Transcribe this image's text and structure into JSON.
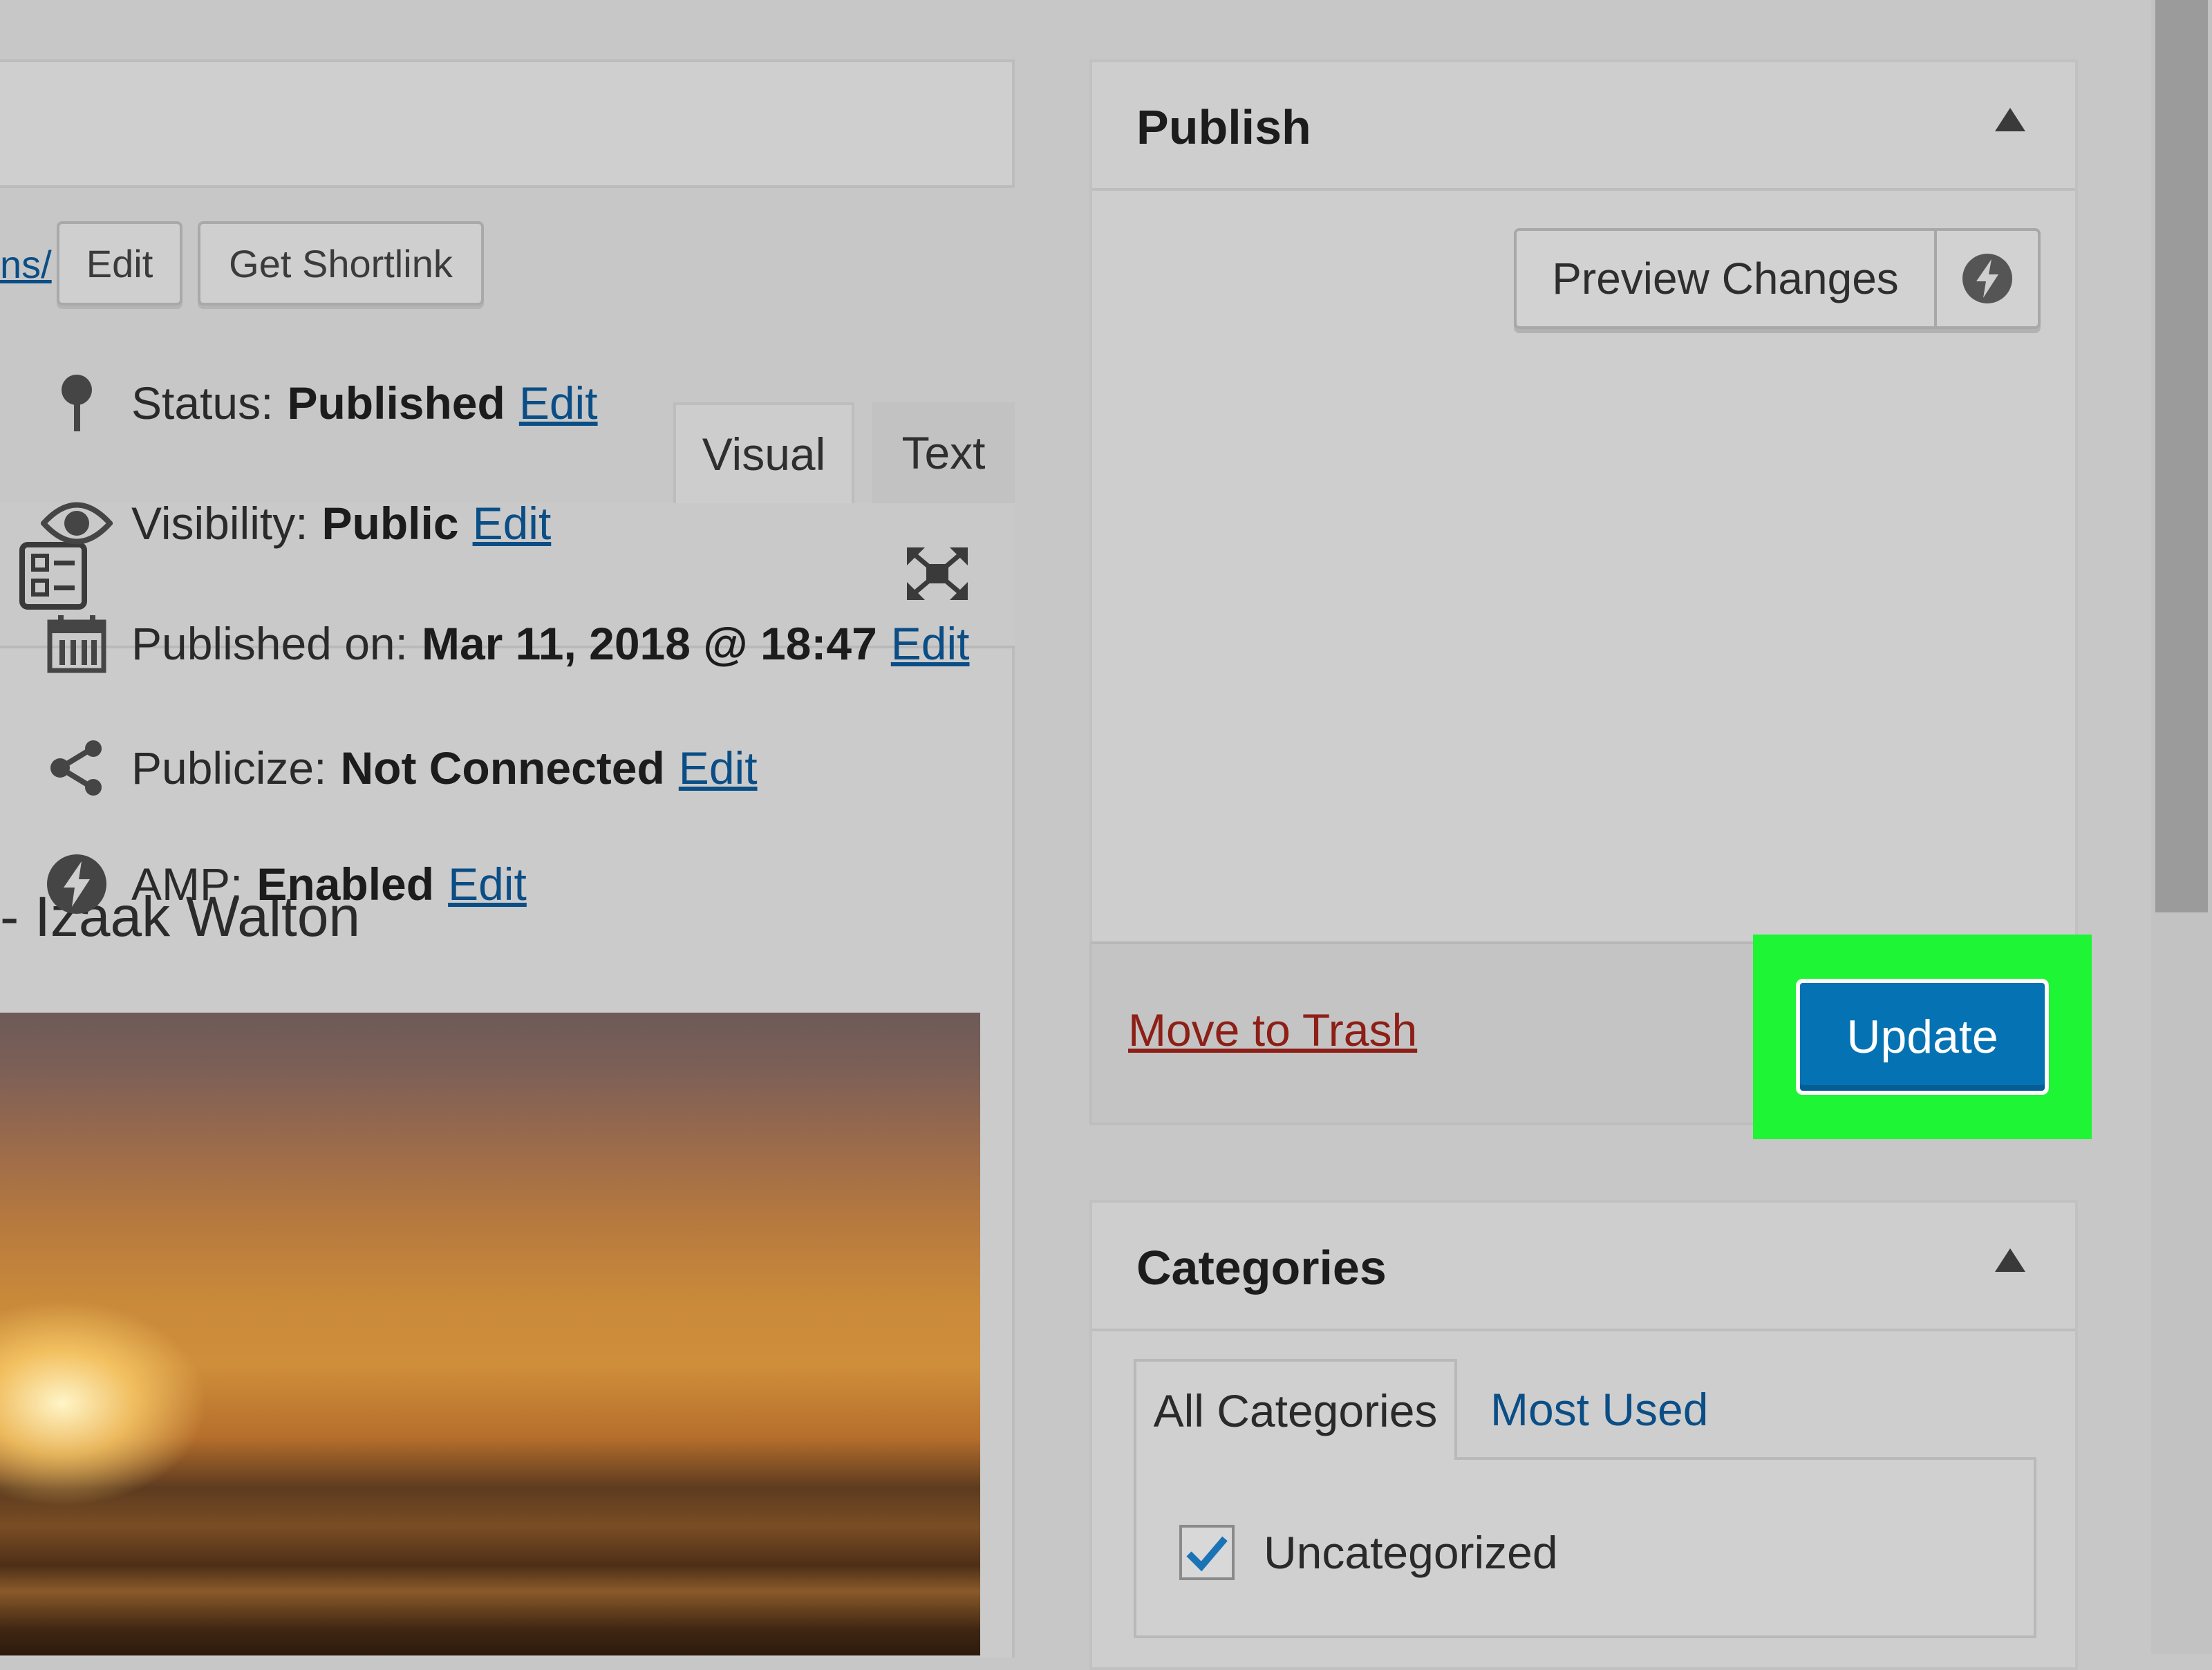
{
  "editor": {
    "permalink_tail": "ns/",
    "edit_button": "Edit",
    "shortlink_button": "Get Shortlink",
    "tabs": [
      {
        "label": "Visual",
        "active": true
      },
      {
        "label": "Text",
        "active": false
      }
    ],
    "content_line": "- Izaak Walton"
  },
  "publish": {
    "title": "Publish",
    "preview_button": "Preview Changes",
    "rows": {
      "status": {
        "label": "Status:",
        "value": "Published",
        "link": "Edit"
      },
      "visibility": {
        "label": "Visibility:",
        "value": "Public",
        "link": "Edit"
      },
      "published_on": {
        "label": "Published on:",
        "value": "Mar 11, 2018 @ 18:47",
        "link": "Edit"
      },
      "publicize": {
        "label": "Publicize:",
        "value": "Not Connected",
        "link": "Edit"
      },
      "amp": {
        "label": "AMP:",
        "value": "Enabled",
        "link": "Edit"
      }
    },
    "trash_link": "Move to Trash",
    "update_button": "Update"
  },
  "categories": {
    "title": "Categories",
    "tabs": [
      {
        "label": "All Categories",
        "active": true
      },
      {
        "label": "Most Used",
        "active": false
      }
    ],
    "items": [
      {
        "label": "Uncategorized",
        "checked": true
      }
    ]
  },
  "colors": {
    "primary_button": "#0572b3",
    "highlight": "#1ef535",
    "link": "#0b4e86",
    "trash": "#8d1f17"
  }
}
